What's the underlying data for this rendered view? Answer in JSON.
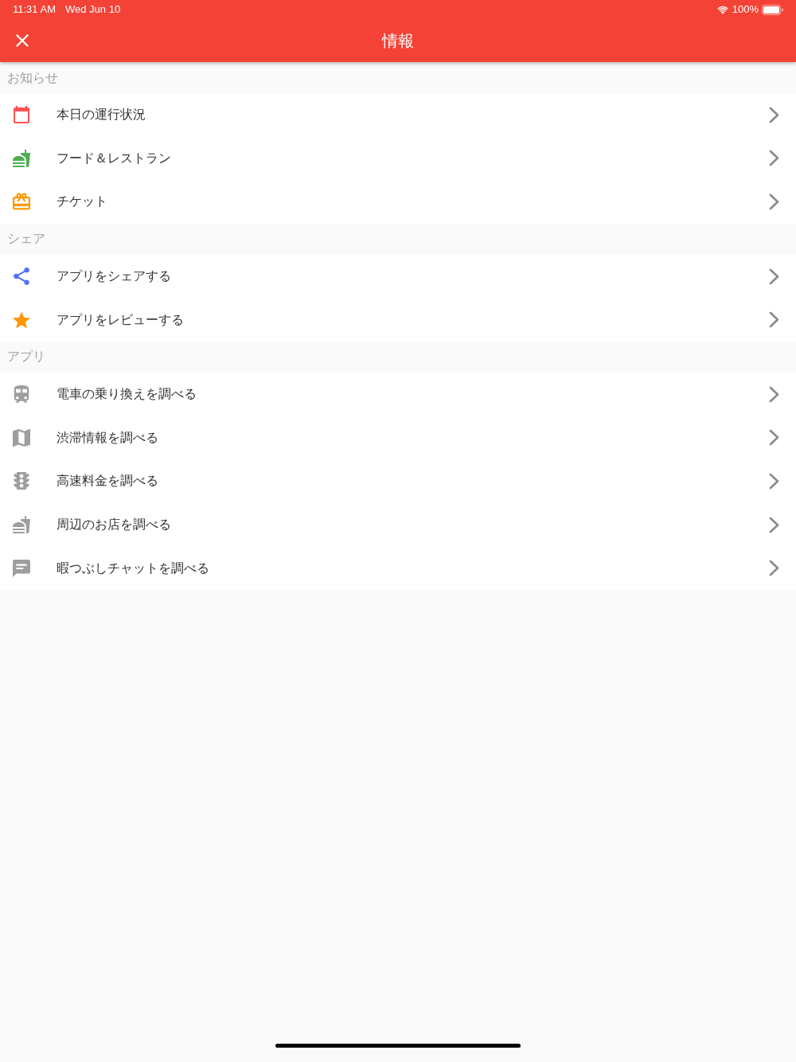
{
  "status_bar": {
    "time": "11:31 AM",
    "date": "Wed Jun 10",
    "battery": "100%"
  },
  "header": {
    "title": "情報"
  },
  "sections": [
    {
      "title": "お知らせ",
      "items": [
        {
          "label": "本日の運行状況",
          "kind": "calendar",
          "color": "#ff5252"
        },
        {
          "label": "フード＆レストラン",
          "kind": "food",
          "color": "#4caf50"
        },
        {
          "label": "チケット",
          "kind": "gift",
          "color": "#ff9800"
        }
      ]
    },
    {
      "title": "シェア",
      "items": [
        {
          "label": "アプリをシェアする",
          "kind": "share",
          "color": "#536dfe"
        },
        {
          "label": "アプリをレビューする",
          "kind": "star",
          "color": "#ff9800"
        }
      ]
    },
    {
      "title": "アプリ",
      "items": [
        {
          "label": "電車の乗り換えを調べる",
          "kind": "train",
          "color": "#9e9e9e"
        },
        {
          "label": "渋滞情報を調べる",
          "kind": "map",
          "color": "#9e9e9e"
        },
        {
          "label": "高速料金を調べる",
          "kind": "traffic",
          "color": "#9e9e9e"
        },
        {
          "label": "周辺のお店を調べる",
          "kind": "food",
          "color": "#9e9e9e"
        },
        {
          "label": "暇つぶしチャットを調べる",
          "kind": "chat",
          "color": "#9e9e9e"
        }
      ]
    }
  ]
}
